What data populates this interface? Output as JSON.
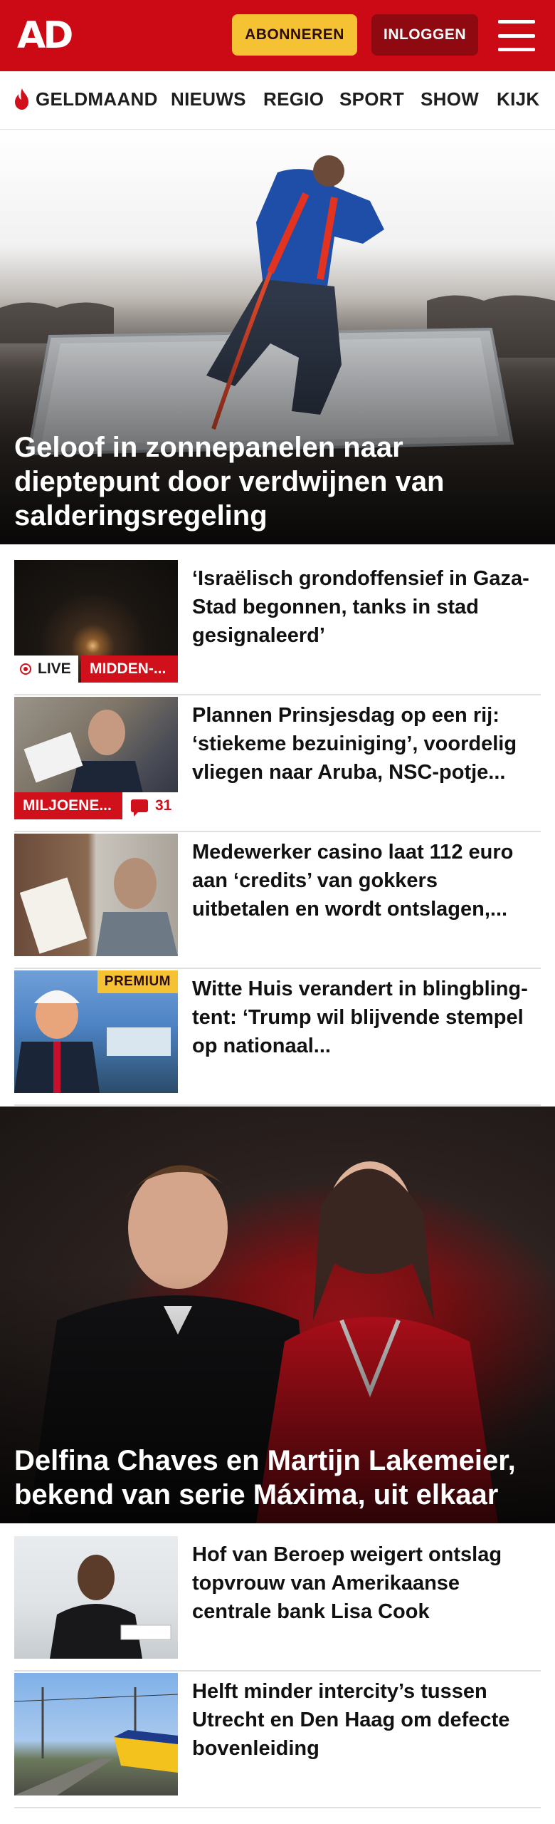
{
  "header": {
    "logo_text": "AD",
    "subscribe_label": "ABONNEREN",
    "login_label": "INLOGGEN",
    "brand_color": "#cc0a16"
  },
  "nav": {
    "items": [
      "GELDMAAND",
      "NIEUWS",
      "REGIO",
      "SPORT",
      "SHOW",
      "KIJK"
    ],
    "highlight_icon": "flame-icon"
  },
  "hero_top": {
    "headline": "Geloof in zonnepanelen naar dieptepunt door verdwijnen van salderingsregeling"
  },
  "articles_1": [
    {
      "title": "‘Israëlisch grondoffensief in Gaza-Stad begonnen, tanks in stad gesignaleerd’",
      "live_label": "LIVE",
      "category": "MIDDEN-..."
    },
    {
      "title": "Plannen Prinsjesdag op een rij: ‘stiekeme bezuiniging’, voordelig vliegen naar Aruba, NSC-potje...",
      "category": "MILJOENE...",
      "comments": "31"
    },
    {
      "title": "Medewerker casino laat 112 euro aan ‘credits’ van gokkers uitbetalen en wordt ontslagen,..."
    },
    {
      "title": "Witte Huis verandert in blingbling-tent: ‘Trump wil blijvende stempel op nationaal...",
      "premium_label": "PREMIUM"
    }
  ],
  "hero_mid": {
    "headline": "Delfina Chaves en Martijn Lakemeier, bekend van serie Máxima, uit elkaar"
  },
  "articles_2": [
    {
      "title": "Hof van Beroep weigert ontslag topvrouw van Amerikaanse centrale bank Lisa Cook"
    },
    {
      "title": "Helft minder intercity’s tussen Utrecht en Den Haag om defecte bovenleiding"
    }
  ]
}
